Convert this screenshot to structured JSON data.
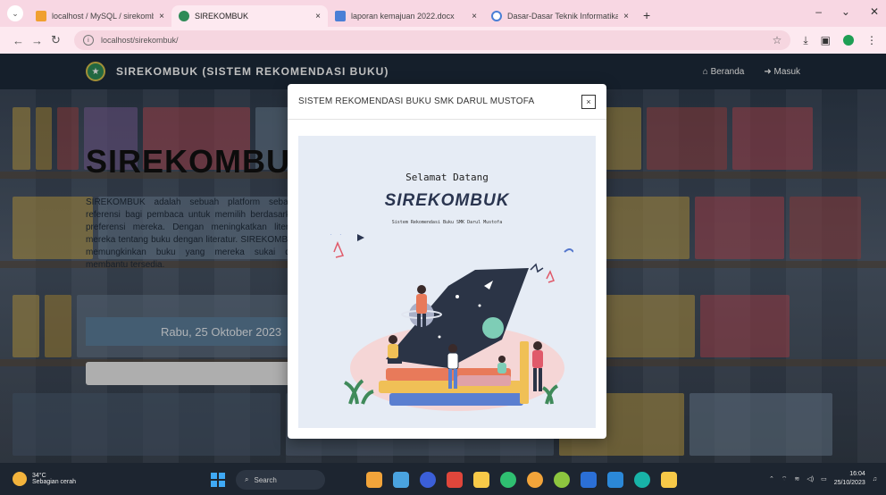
{
  "browser": {
    "tabs": [
      {
        "title": "localhost / MySQL / sirekombuk",
        "favicon_color": "#f0a030",
        "active": false
      },
      {
        "title": "SIREKOMBUK",
        "favicon_color": "#2e8b57",
        "active": true
      },
      {
        "title": "laporan kemajuan 2022.docx",
        "favicon_color": "#4a7fd6",
        "active": false
      },
      {
        "title": "Dasar-Dasar Teknik Informatika",
        "favicon_color": "#4a7fd6",
        "active": false
      }
    ],
    "new_tab_glyph": "+",
    "url": "localhost/sirekombuk/",
    "window_controls": [
      "–",
      "⌄",
      "✕"
    ]
  },
  "navbar": {
    "brand": "SIREKOMBUK (SISTEM REKOMENDASI BUKU)",
    "links": [
      "Beranda",
      "Masuk"
    ]
  },
  "hero": {
    "title": "SIREKOMBUK",
    "description": "SIREKOMBUK adalah sebuah platform sebagai referensi bagi pembaca untuk memilih berdasarkan preferensi mereka. Dengan meningkatkan literasi mereka tentang buku dengan literatur. SIREKOMBUK memungkinkan buku yang mereka sukai dan membantu tersedia.",
    "date": "Rabu, 25 Oktober 2023"
  },
  "modal": {
    "title": "SISTEM REKOMENDASI BUKU SMK DARUL MUSTOFA",
    "close_glyph": "×",
    "welcome": "Selamat Datang",
    "brand": "SIREKOMBUK",
    "subtitle": "Sistem Rekomendasi Buku SMK Darul Mustofa"
  },
  "taskbar": {
    "weather_temp": "34°C",
    "weather_desc": "Sebagian cerah",
    "search": "Search",
    "time": "16:04",
    "date": "25/10/2023",
    "app_colors": [
      "#f2a43a",
      "#4aa3df",
      "#3b5fd9",
      "#e0463b",
      "#f7c948",
      "#2fbf71",
      "#f2a43a",
      "#8dc63f",
      "#2b6fd6",
      "#2b88d8",
      "#18b3a8",
      "#f7c948"
    ]
  },
  "colors": {
    "browser_tabbar": "#f8d7e3",
    "navbar": "#1c2a3a",
    "date_box": "#5b7c99",
    "modal_body": "#e6ecf5"
  }
}
